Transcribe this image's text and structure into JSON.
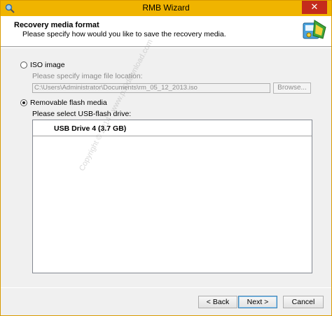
{
  "window": {
    "title": "RMB Wizard",
    "close_glyph": "✕"
  },
  "header": {
    "title": "Recovery media format",
    "subtitle": "Please specify how would you like to save the recovery media.",
    "icon": "wizard-logo-icon"
  },
  "options": {
    "iso": {
      "label": "ISO image",
      "checked": false,
      "path_label": "Please specify image file location:",
      "path_value": "C:\\Users\\Administrator\\Documents\\rm_05_12_2013.iso",
      "browse_label": "Browse..."
    },
    "usb": {
      "label": "Removable flash media",
      "checked": true,
      "drive_label": "Please select USB-flash drive:",
      "drives": [
        "USB Drive 4 (3.7 GB)"
      ]
    }
  },
  "watermark": "Copyright © 2014 - www.p30download.com",
  "buttons": {
    "back": "< Back",
    "next": "Next >",
    "cancel": "Cancel"
  }
}
